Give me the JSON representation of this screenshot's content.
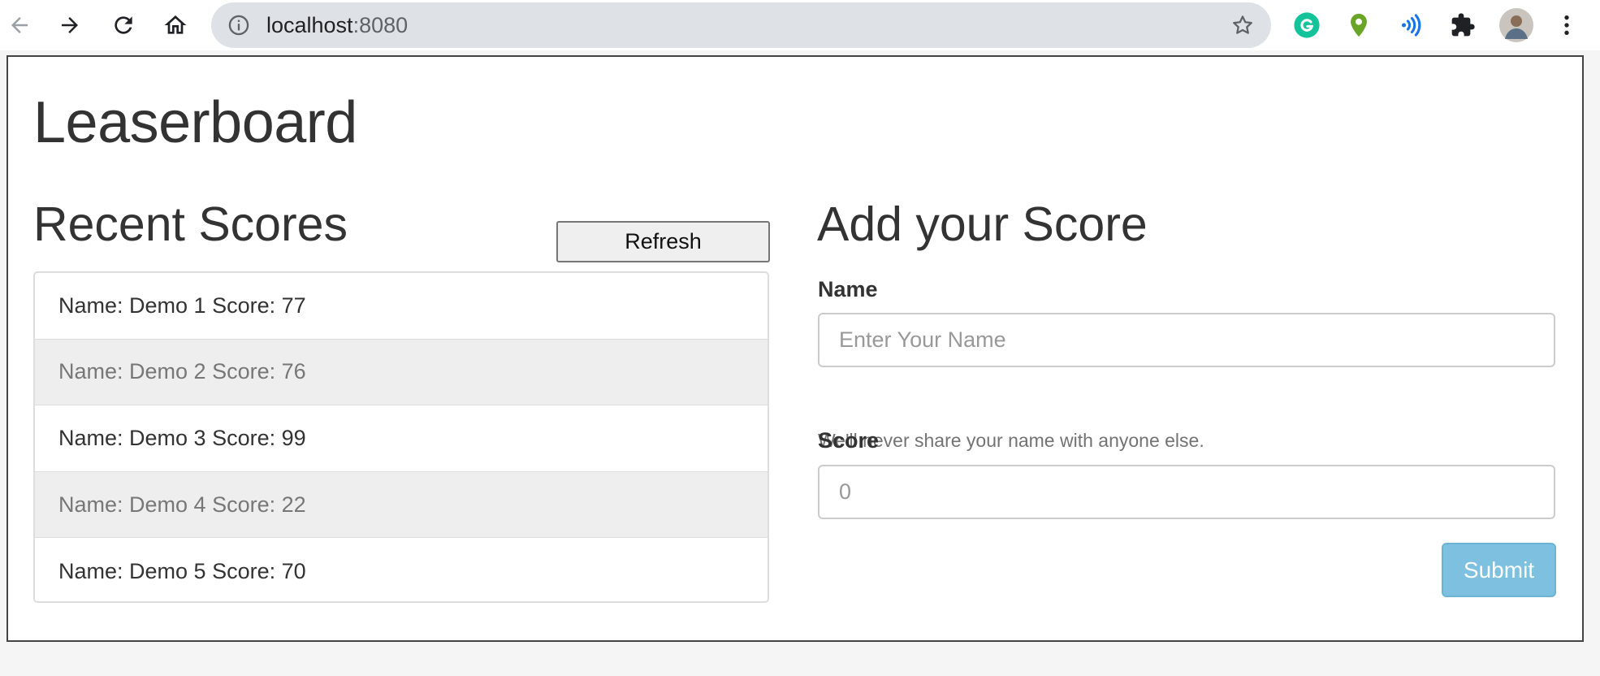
{
  "browser": {
    "url_host": "localhost",
    "url_port": ":8080"
  },
  "app": {
    "title": "Leaserboard"
  },
  "recent_scores": {
    "title": "Recent Scores",
    "refresh_label": "Refresh",
    "items": [
      {
        "text": "Name: Demo 1 Score: 77"
      },
      {
        "text": "Name: Demo 2 Score: 76"
      },
      {
        "text": "Name: Demo 3 Score: 99"
      },
      {
        "text": "Name: Demo 4 Score: 22"
      },
      {
        "text": "Name: Demo 5 Score: 70"
      }
    ]
  },
  "add_score": {
    "title": "Add your Score",
    "name_label": "Name",
    "name_placeholder": "Enter Your Name",
    "name_help": "We'll never share your name with anyone else.",
    "score_label": "Score",
    "score_placeholder": "0",
    "submit_label": "Submit"
  },
  "colors": {
    "submit_bg": "#7dc0df",
    "list_alt_bg": "#eeeeee",
    "text_primary": "#333333"
  },
  "icons": [
    "back-icon",
    "forward-icon",
    "reload-icon",
    "home-icon",
    "info-icon",
    "star-icon",
    "grammarly-icon",
    "location-pin-icon",
    "broadcast-icon",
    "puzzle-icon",
    "avatar",
    "kebab-menu-icon"
  ]
}
